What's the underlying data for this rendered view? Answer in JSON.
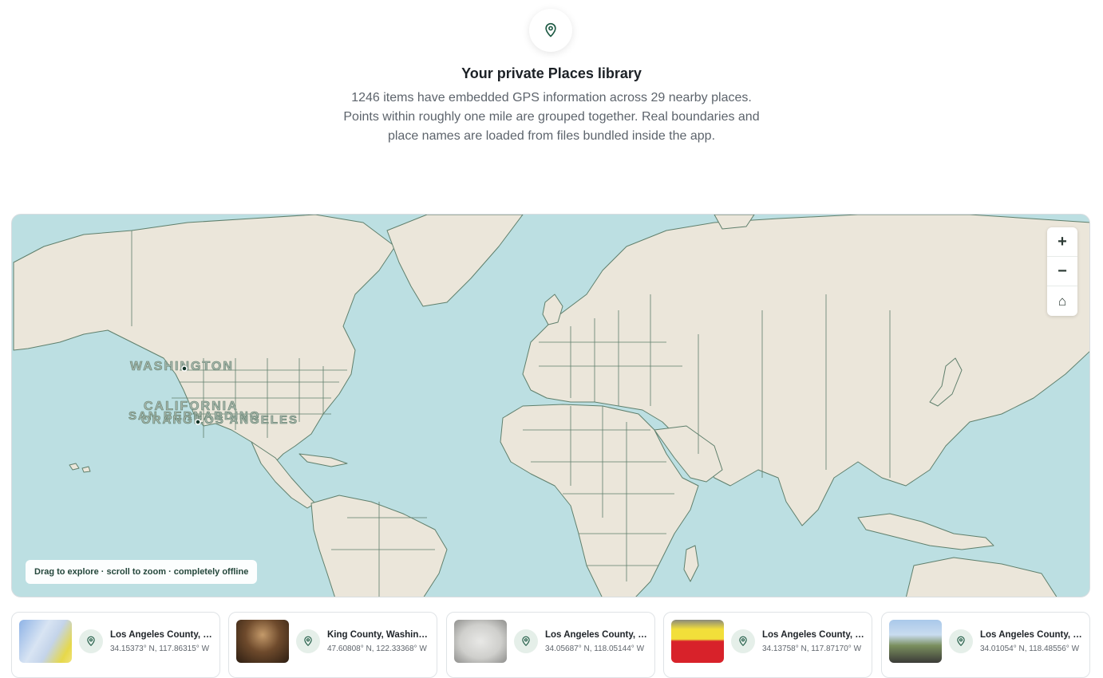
{
  "header": {
    "icon": "map-pin-icon",
    "title": "Your private Places library",
    "description": "1246 items have embedded GPS information across 29 nearby places. Points within roughly one mile are grouped together. Real boundaries and place names are loaded from files bundled inside the app."
  },
  "map": {
    "labels": {
      "washington": "WASHINGTON",
      "california": "CALIFORNIA",
      "san_bernardino": "SAN BERNARDINO",
      "orange": "ORANGE",
      "los_angeles": "LOS ANGELES"
    },
    "controls": {
      "zoom_in": "+",
      "zoom_out": "−",
      "home": "⌂"
    },
    "hint": "Drag to explore · scroll to zoom · completely offline",
    "colors": {
      "water": "#bcdfe2",
      "land": "#ebe6da",
      "border": "#5f7f6c",
      "accent": "#1e5a44"
    }
  },
  "places": [
    {
      "title": "Los Angeles County, California",
      "coords": "34.15373° N, 117.86315° W"
    },
    {
      "title": "King County, Washington",
      "coords": "47.60808° N, 122.33368° W"
    },
    {
      "title": "Los Angeles County, California",
      "coords": "34.05687° N, 118.05144° W"
    },
    {
      "title": "Los Angeles County, California",
      "coords": "34.13758° N, 117.87170° W"
    },
    {
      "title": "Los Angeles County, California",
      "coords": "34.01054° N, 118.48556° W"
    }
  ]
}
